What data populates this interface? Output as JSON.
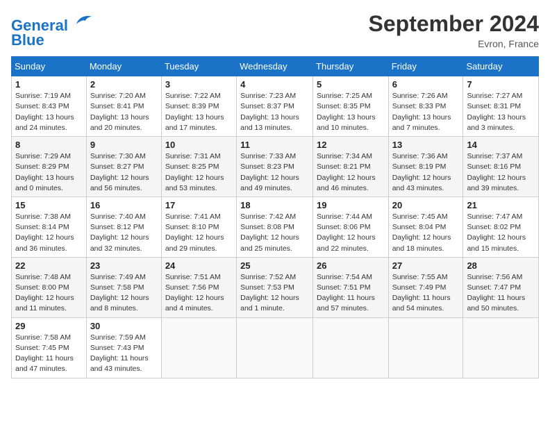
{
  "header": {
    "logo_line1": "General",
    "logo_line2": "Blue",
    "month_title": "September 2024",
    "location": "Evron, France"
  },
  "days_of_week": [
    "Sunday",
    "Monday",
    "Tuesday",
    "Wednesday",
    "Thursday",
    "Friday",
    "Saturday"
  ],
  "weeks": [
    [
      {
        "day": "1",
        "info": "Sunrise: 7:19 AM\nSunset: 8:43 PM\nDaylight: 13 hours\nand 24 minutes."
      },
      {
        "day": "2",
        "info": "Sunrise: 7:20 AM\nSunset: 8:41 PM\nDaylight: 13 hours\nand 20 minutes."
      },
      {
        "day": "3",
        "info": "Sunrise: 7:22 AM\nSunset: 8:39 PM\nDaylight: 13 hours\nand 17 minutes."
      },
      {
        "day": "4",
        "info": "Sunrise: 7:23 AM\nSunset: 8:37 PM\nDaylight: 13 hours\nand 13 minutes."
      },
      {
        "day": "5",
        "info": "Sunrise: 7:25 AM\nSunset: 8:35 PM\nDaylight: 13 hours\nand 10 minutes."
      },
      {
        "day": "6",
        "info": "Sunrise: 7:26 AM\nSunset: 8:33 PM\nDaylight: 13 hours\nand 7 minutes."
      },
      {
        "day": "7",
        "info": "Sunrise: 7:27 AM\nSunset: 8:31 PM\nDaylight: 13 hours\nand 3 minutes."
      }
    ],
    [
      {
        "day": "8",
        "info": "Sunrise: 7:29 AM\nSunset: 8:29 PM\nDaylight: 13 hours\nand 0 minutes."
      },
      {
        "day": "9",
        "info": "Sunrise: 7:30 AM\nSunset: 8:27 PM\nDaylight: 12 hours\nand 56 minutes."
      },
      {
        "day": "10",
        "info": "Sunrise: 7:31 AM\nSunset: 8:25 PM\nDaylight: 12 hours\nand 53 minutes."
      },
      {
        "day": "11",
        "info": "Sunrise: 7:33 AM\nSunset: 8:23 PM\nDaylight: 12 hours\nand 49 minutes."
      },
      {
        "day": "12",
        "info": "Sunrise: 7:34 AM\nSunset: 8:21 PM\nDaylight: 12 hours\nand 46 minutes."
      },
      {
        "day": "13",
        "info": "Sunrise: 7:36 AM\nSunset: 8:19 PM\nDaylight: 12 hours\nand 43 minutes."
      },
      {
        "day": "14",
        "info": "Sunrise: 7:37 AM\nSunset: 8:16 PM\nDaylight: 12 hours\nand 39 minutes."
      }
    ],
    [
      {
        "day": "15",
        "info": "Sunrise: 7:38 AM\nSunset: 8:14 PM\nDaylight: 12 hours\nand 36 minutes."
      },
      {
        "day": "16",
        "info": "Sunrise: 7:40 AM\nSunset: 8:12 PM\nDaylight: 12 hours\nand 32 minutes."
      },
      {
        "day": "17",
        "info": "Sunrise: 7:41 AM\nSunset: 8:10 PM\nDaylight: 12 hours\nand 29 minutes."
      },
      {
        "day": "18",
        "info": "Sunrise: 7:42 AM\nSunset: 8:08 PM\nDaylight: 12 hours\nand 25 minutes."
      },
      {
        "day": "19",
        "info": "Sunrise: 7:44 AM\nSunset: 8:06 PM\nDaylight: 12 hours\nand 22 minutes."
      },
      {
        "day": "20",
        "info": "Sunrise: 7:45 AM\nSunset: 8:04 PM\nDaylight: 12 hours\nand 18 minutes."
      },
      {
        "day": "21",
        "info": "Sunrise: 7:47 AM\nSunset: 8:02 PM\nDaylight: 12 hours\nand 15 minutes."
      }
    ],
    [
      {
        "day": "22",
        "info": "Sunrise: 7:48 AM\nSunset: 8:00 PM\nDaylight: 12 hours\nand 11 minutes."
      },
      {
        "day": "23",
        "info": "Sunrise: 7:49 AM\nSunset: 7:58 PM\nDaylight: 12 hours\nand 8 minutes."
      },
      {
        "day": "24",
        "info": "Sunrise: 7:51 AM\nSunset: 7:56 PM\nDaylight: 12 hours\nand 4 minutes."
      },
      {
        "day": "25",
        "info": "Sunrise: 7:52 AM\nSunset: 7:53 PM\nDaylight: 12 hours\nand 1 minute."
      },
      {
        "day": "26",
        "info": "Sunrise: 7:54 AM\nSunset: 7:51 PM\nDaylight: 11 hours\nand 57 minutes."
      },
      {
        "day": "27",
        "info": "Sunrise: 7:55 AM\nSunset: 7:49 PM\nDaylight: 11 hours\nand 54 minutes."
      },
      {
        "day": "28",
        "info": "Sunrise: 7:56 AM\nSunset: 7:47 PM\nDaylight: 11 hours\nand 50 minutes."
      }
    ],
    [
      {
        "day": "29",
        "info": "Sunrise: 7:58 AM\nSunset: 7:45 PM\nDaylight: 11 hours\nand 47 minutes."
      },
      {
        "day": "30",
        "info": "Sunrise: 7:59 AM\nSunset: 7:43 PM\nDaylight: 11 hours\nand 43 minutes."
      },
      {
        "day": "",
        "info": ""
      },
      {
        "day": "",
        "info": ""
      },
      {
        "day": "",
        "info": ""
      },
      {
        "day": "",
        "info": ""
      },
      {
        "day": "",
        "info": ""
      }
    ]
  ]
}
